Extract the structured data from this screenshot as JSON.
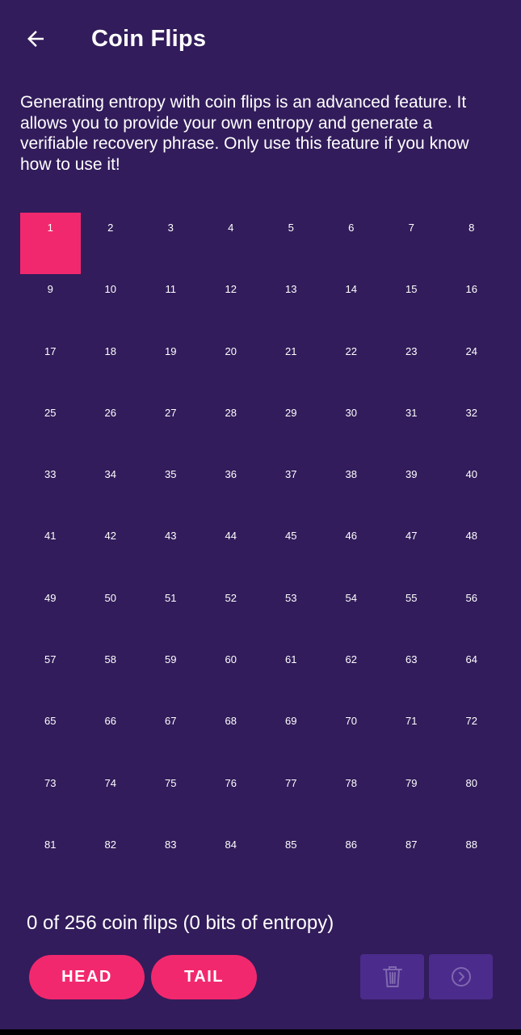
{
  "header": {
    "title": "Coin Flips",
    "back_icon": "arrow-left-icon"
  },
  "description": "Generating entropy with coin flips is an advanced feature. It allows you to provide your own entropy and generate a verifiable recovery phrase. Only use this feature if you know how to use it!",
  "grid": {
    "active_index": 1,
    "cells": [
      "1",
      "2",
      "3",
      "4",
      "5",
      "6",
      "7",
      "8",
      "9",
      "10",
      "11",
      "12",
      "13",
      "14",
      "15",
      "16",
      "17",
      "18",
      "19",
      "20",
      "21",
      "22",
      "23",
      "24",
      "25",
      "26",
      "27",
      "28",
      "29",
      "30",
      "31",
      "32",
      "33",
      "34",
      "35",
      "36",
      "37",
      "38",
      "39",
      "40",
      "41",
      "42",
      "43",
      "44",
      "45",
      "46",
      "47",
      "48",
      "49",
      "50",
      "51",
      "52",
      "53",
      "54",
      "55",
      "56",
      "57",
      "58",
      "59",
      "60",
      "61",
      "62",
      "63",
      "64",
      "65",
      "66",
      "67",
      "68",
      "69",
      "70",
      "71",
      "72",
      "73",
      "74",
      "75",
      "76",
      "77",
      "78",
      "79",
      "80",
      "81",
      "82",
      "83",
      "84",
      "85",
      "86",
      "87",
      "88"
    ]
  },
  "status": {
    "text": "0 of 256 coin flips (0 bits of entropy)"
  },
  "actions": {
    "head_label": "HEAD",
    "tail_label": "TAIL",
    "delete_icon": "trash-icon",
    "next_icon": "chevron-right-circle-icon"
  },
  "colors": {
    "background": "#321c5b",
    "accent": "#f2286e",
    "secondary_button": "#4b2b8c"
  }
}
